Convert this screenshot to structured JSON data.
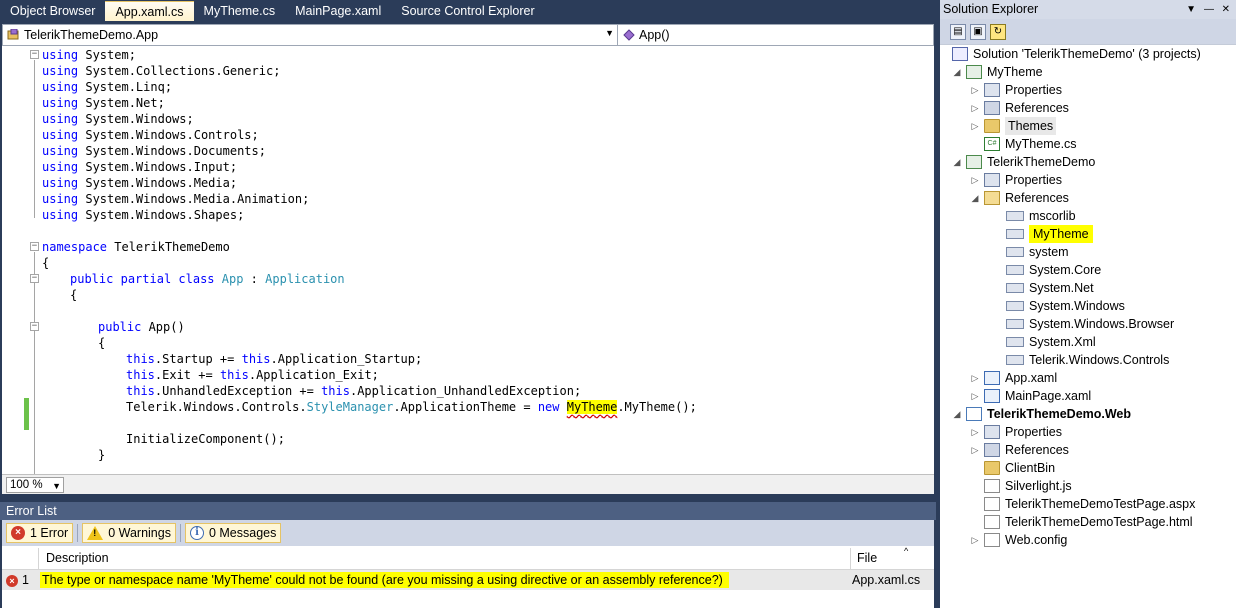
{
  "tabs": [
    "Object Browser",
    "App.xaml.cs",
    "MyTheme.cs",
    "MainPage.xaml",
    "Source Control Explorer"
  ],
  "active_tab": "App.xaml.cs",
  "navbar": {
    "class_combo": "TelerikThemeDemo.App",
    "member_combo": "App()"
  },
  "code": {
    "usings": [
      "System;",
      "System.Collections.Generic;",
      "System.Linq;",
      "System.Net;",
      "System.Windows;",
      "System.Windows.Controls;",
      "System.Windows.Documents;",
      "System.Windows.Input;",
      "System.Windows.Media;",
      "System.Windows.Media.Animation;",
      "System.Windows.Shapes;"
    ],
    "kw_using": "using",
    "kw_namespace": "namespace",
    "namespace_name": " TelerikThemeDemo",
    "brace_open": "{",
    "brace_close": "}",
    "kw_public": "public",
    "kw_partial": "partial",
    "kw_class": "class",
    "class_name": "App",
    "colon": " : ",
    "base_class": "Application",
    "ctor_sig": " App()",
    "kw_this": "this",
    "startup_mid": ".Startup += ",
    "startup_end": ".Application_Startup;",
    "exit_mid": ".Exit += ",
    "exit_end": ".Application_Exit;",
    "unh_mid": ".UnhandledException += ",
    "unh_end": ".Application_UnhandledException;",
    "theme_pre": "Telerik.Windows.Controls.",
    "theme_type": "StyleManager",
    "theme_mid": ".ApplicationTheme = ",
    "kw_new": "new",
    "theme_ns": "MyTheme",
    "theme_end": ".MyTheme();",
    "init": "InitializeComponent();"
  },
  "zoom": "100 %",
  "error_list": {
    "title": "Error List",
    "filters": {
      "errors": "1 Error",
      "warnings": "0 Warnings",
      "messages": "0 Messages"
    },
    "columns": {
      "description": "Description",
      "file": "File"
    },
    "rows": [
      {
        "index": "1",
        "description": "The type or namespace name 'MyTheme' could not be found (are you missing a using directive or an assembly reference?)",
        "file": "App.xaml.cs"
      }
    ]
  },
  "solution_explorer": {
    "title": "Solution Explorer",
    "title_pin": "—",
    "title_close": "✕",
    "items": [
      "Solution 'TelerikThemeDemo' (3 projects)",
      "MyTheme",
      "Properties",
      "References",
      "Themes",
      "MyTheme.cs",
      "TelerikThemeDemo",
      "Properties",
      "References",
      "mscorlib",
      "MyTheme",
      "system",
      "System.Core",
      "System.Net",
      "System.Windows",
      "System.Windows.Browser",
      "System.Xml",
      "Telerik.Windows.Controls",
      "App.xaml",
      "MainPage.xaml",
      "TelerikThemeDemo.Web",
      "Properties",
      "References",
      "ClientBin",
      "Silverlight.js",
      "TelerikThemeDemoTestPage.aspx",
      "TelerikThemeDemoTestPage.html",
      "Web.config"
    ]
  },
  "colors": {
    "chrome": "#2b3c59",
    "keyword": "#0000ff",
    "type": "#2b91af",
    "highlight": "#ffff00",
    "error_icon": "#d13a2a"
  }
}
